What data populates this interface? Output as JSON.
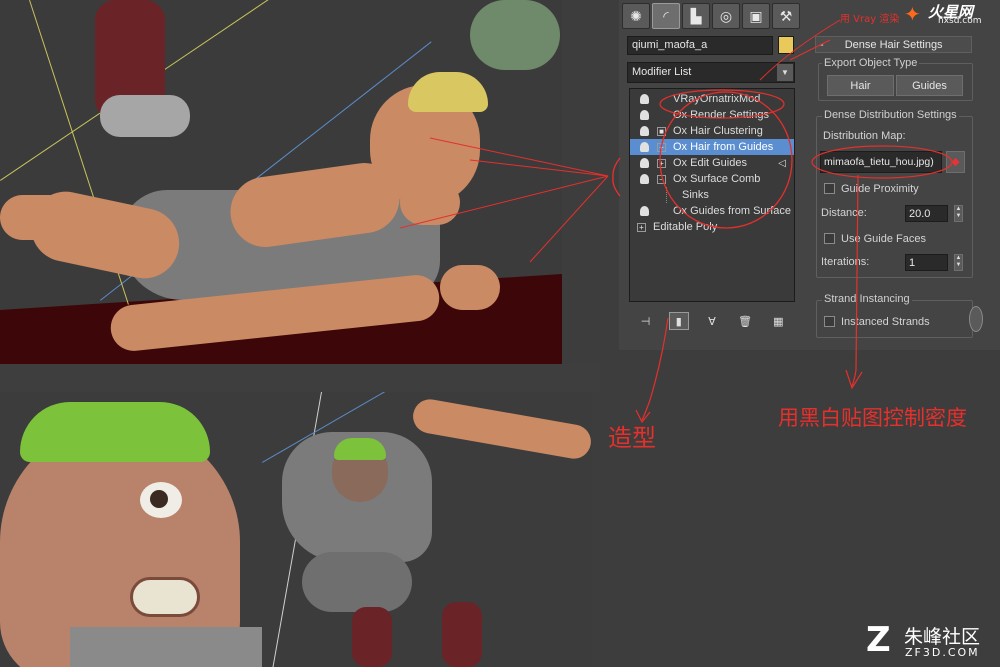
{
  "command_panel": {
    "tabs": [
      {
        "icon": "create-sun-icon",
        "glyph": "✺"
      },
      {
        "icon": "modify-arc-icon",
        "glyph": "◜"
      },
      {
        "icon": "hierarchy-icon",
        "glyph": "▙"
      },
      {
        "icon": "motion-icon",
        "glyph": "◎"
      },
      {
        "icon": "display-monitor-icon",
        "glyph": "▣"
      },
      {
        "icon": "utilities-hammer-icon",
        "glyph": "⚒"
      }
    ],
    "object_name": "qiumi_maofa_a",
    "object_color": "#e8c95a",
    "modifier_list_label": "Modifier List",
    "stack": [
      {
        "label": "VRayOrnatrixMod",
        "kind": "bulb",
        "selected": false
      },
      {
        "label": "Ox Render Settings",
        "kind": "bulb",
        "selected": false
      },
      {
        "label": "Ox Hair Clustering",
        "kind": "bulb-box",
        "selected": false
      },
      {
        "label": "Ox Hair from Guides",
        "kind": "bulb-plus",
        "selected": true
      },
      {
        "label": "Ox Edit Guides",
        "kind": "bulb-plus",
        "selected": false,
        "extra_icon": "◁"
      },
      {
        "label": "Ox Surface Comb",
        "kind": "bulb-minus",
        "selected": false
      },
      {
        "label": "Sinks",
        "kind": "sub",
        "selected": false
      },
      {
        "label": "Ox Guides from Surface",
        "kind": "bulb",
        "selected": false
      },
      {
        "label": "Editable Poly",
        "kind": "plus",
        "selected": false
      }
    ],
    "stack_tools": [
      {
        "icon": "pin-stack-icon",
        "glyph": "⊣"
      },
      {
        "icon": "show-end-result-icon",
        "glyph": "▮"
      },
      {
        "icon": "make-unique-icon",
        "glyph": "∀"
      },
      {
        "icon": "remove-modifier-icon",
        "glyph": "🗑"
      },
      {
        "icon": "configure-sets-icon",
        "glyph": "▦"
      }
    ]
  },
  "rollout": {
    "title": "Dense Hair Settings",
    "collapse_symbol": "-",
    "export_group": "Export Object Type",
    "hair_button": "Hair",
    "guides_button": "Guides",
    "distribution_group": "Dense Distribution Settings",
    "distribution_map_label": "Distribution Map:",
    "distribution_map_value": "mimaofa_tietu_hou.jpg)",
    "guide_proximity_label": "Guide Proximity",
    "distance_label": "Distance:",
    "distance_value": "20.0",
    "use_guide_faces_label": "Use Guide Faces",
    "iterations_label": "Iterations:",
    "iterations_value": "1",
    "strand_group": "Strand Instancing",
    "instanced_strands_label": "Instanced Strands"
  },
  "annotations": {
    "shape_note": "造型",
    "density_note": "用黑白贴图控制密度",
    "top_note": "用 Vray 渲染",
    "color": "#e5302c"
  },
  "watermarks": {
    "top_brand": "火星网",
    "top_url": "hxsd.com",
    "bottom_brand": "朱峰社区",
    "bottom_url": "ZF3D.COM"
  }
}
